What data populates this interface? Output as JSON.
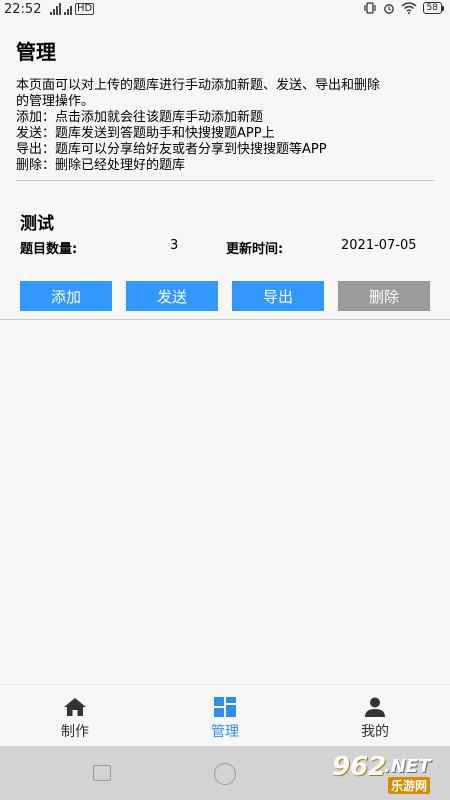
{
  "status_bar": {
    "time": "22:52",
    "battery": "58"
  },
  "page": {
    "title": "管理",
    "description_lines": [
      "本页面可以对上传的题库进行手动添加新题、发送、导出和删除",
      "的管理操作。",
      "添加：点击添加就会往该题库手动添加新题",
      "发送：题库发送到答题助手和快搜搜题APP上",
      "导出：题库可以分享给好友或者分享到快搜搜题等APP",
      "删除：删除已经处理好的题库"
    ]
  },
  "card": {
    "title": "测试",
    "count_label": "题目数量:",
    "count_value": "3",
    "updated_label": "更新时间:",
    "updated_value": "2021-07-05",
    "buttons": {
      "add": "添加",
      "send": "发送",
      "export": "导出",
      "delete": "删除"
    },
    "colors": {
      "primary": "#3298fb",
      "disabled": "#9b9b9b"
    }
  },
  "bottom_nav": {
    "items": [
      {
        "label": "制作",
        "icon": "home-icon"
      },
      {
        "label": "管理",
        "icon": "grid-icon",
        "active": true
      },
      {
        "label": "我的",
        "icon": "person-icon"
      }
    ],
    "active_color": "#2e8ee8"
  },
  "watermark": {
    "number": "962",
    "suffix": ".NET",
    "site_name": "乐游网"
  }
}
